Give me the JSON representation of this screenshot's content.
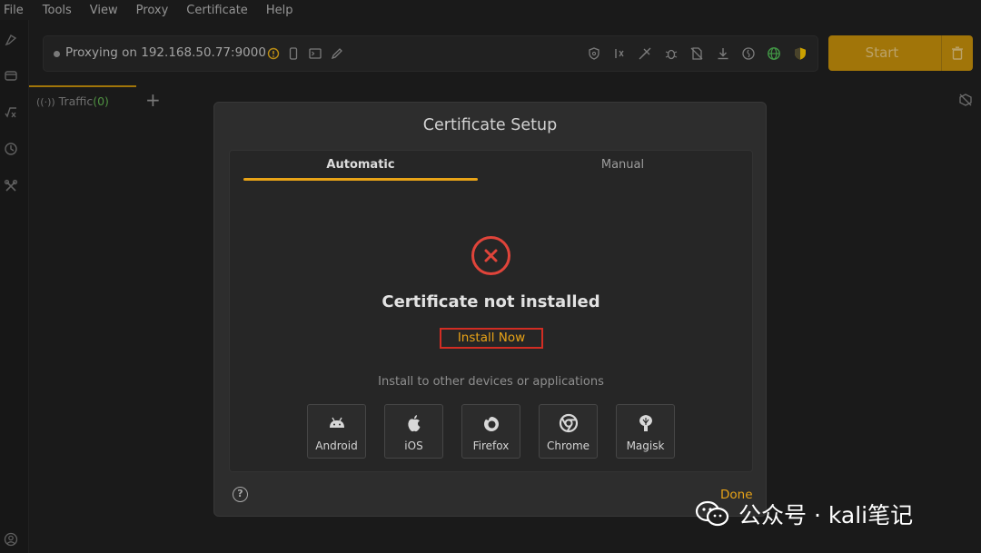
{
  "menu": [
    "File",
    "Tools",
    "View",
    "Proxy",
    "Certificate",
    "Help"
  ],
  "proxy": {
    "status_text": "Proxying on 192.168.50.77:9000"
  },
  "toolbar": {
    "start_label": "Start"
  },
  "tabs": {
    "traffic_label": "Traffic",
    "traffic_count": "(0)"
  },
  "dialog": {
    "title": "Certificate Setup",
    "tab_automatic": "Automatic",
    "tab_manual": "Manual",
    "status_title": "Certificate not installed",
    "install_label": "Install Now",
    "other_label": "Install to other devices or applications",
    "devices": [
      {
        "label": "Android",
        "icon": "android-icon"
      },
      {
        "label": "iOS",
        "icon": "apple-icon"
      },
      {
        "label": "Firefox",
        "icon": "firefox-icon"
      },
      {
        "label": "Chrome",
        "icon": "chrome-icon"
      },
      {
        "label": "Magisk",
        "icon": "magisk-icon"
      }
    ],
    "done_label": "Done"
  },
  "watermark": {
    "text": "公众号 · kali笔记"
  },
  "colors": {
    "accent": "#e8a317",
    "start_button": "#b8860b",
    "error": "#e0443a",
    "highlight_box": "#d22d23",
    "traffic_count": "#5aa64b"
  }
}
